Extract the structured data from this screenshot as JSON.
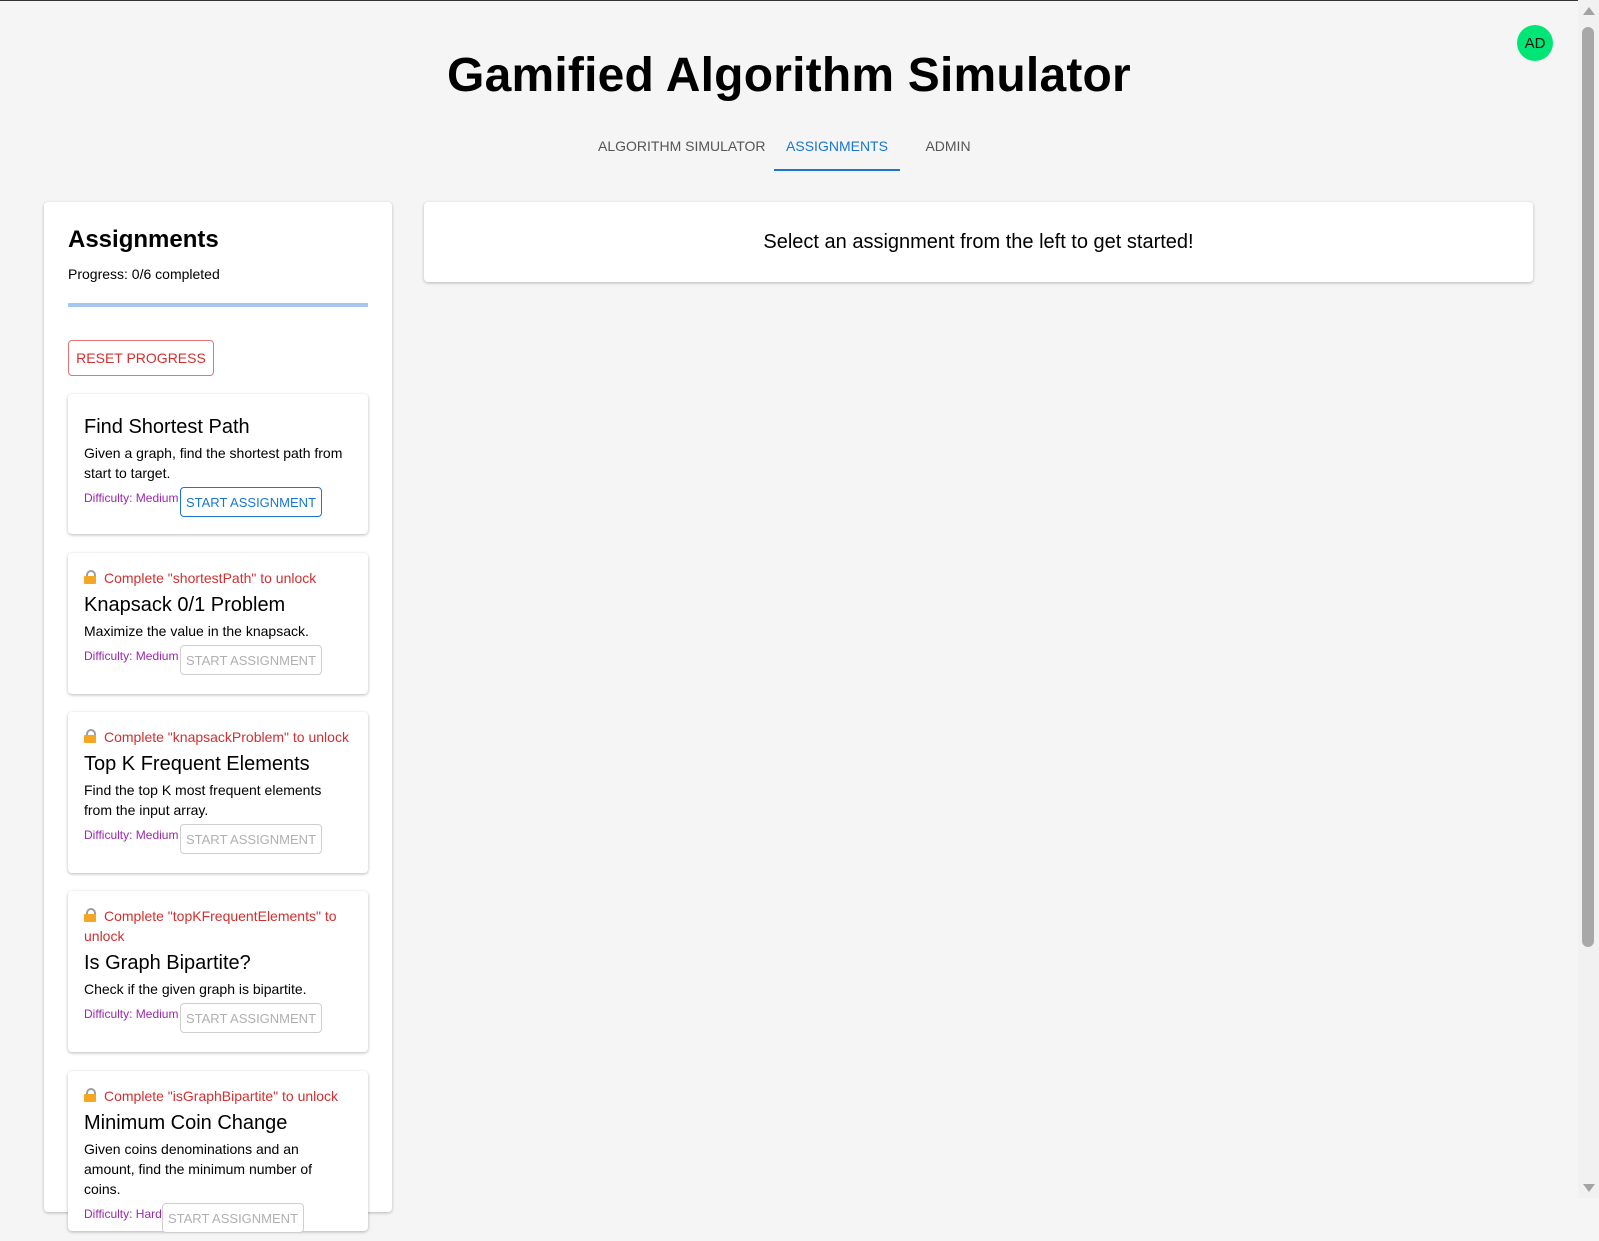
{
  "header": {
    "title": "Gamified Algorithm Simulator",
    "avatar_initials": "AD",
    "avatar_color": "#00e676"
  },
  "tabs": [
    {
      "label": "ALGORITHM SIMULATOR",
      "active": false
    },
    {
      "label": "ASSIGNMENTS",
      "active": true
    },
    {
      "label": "ADMIN",
      "active": false
    }
  ],
  "sidebar": {
    "title": "Assignments",
    "progress_text": "Progress: 0/6 completed",
    "progress_fraction": 0,
    "reset_label": "RESET PROGRESS",
    "assignments": [
      {
        "lock_text": "",
        "title": "Find Shortest Path",
        "description": "Given a graph, find the shortest path from start to target.",
        "difficulty": "Difficulty: Medium",
        "button": "START ASSIGNMENT",
        "locked": false
      },
      {
        "lock_text": "Complete \"shortestPath\" to unlock",
        "title": "Knapsack 0/1 Problem",
        "description": "Maximize the value in the knapsack.",
        "difficulty": "Difficulty: Medium",
        "button": "START ASSIGNMENT",
        "locked": true
      },
      {
        "lock_text": "Complete \"knapsackProblem\" to unlock",
        "title": "Top K Frequent Elements",
        "description": "Find the top K most frequent elements from the input array.",
        "difficulty": "Difficulty: Medium",
        "button": "START ASSIGNMENT",
        "locked": true
      },
      {
        "lock_text": "Complete \"topKFrequentElements\" to unlock",
        "title": "Is Graph Bipartite?",
        "description": "Check if the given graph is bipartite.",
        "difficulty": "Difficulty: Medium",
        "button": "START ASSIGNMENT",
        "locked": true
      },
      {
        "lock_text": "Complete \"isGraphBipartite\" to unlock",
        "title": "Minimum Coin Change",
        "description": "Given coins denominations and an amount, find the minimum number of coins.",
        "difficulty": "Difficulty: Hard",
        "button": "START ASSIGNMENT",
        "locked": true
      }
    ]
  },
  "main": {
    "message": "Select an assignment from the left to get started!"
  },
  "colors": {
    "accent": "#1976d2",
    "lock_text": "#d32f2f",
    "difficulty": "#9c27b0",
    "background": "#f5f5f5"
  }
}
